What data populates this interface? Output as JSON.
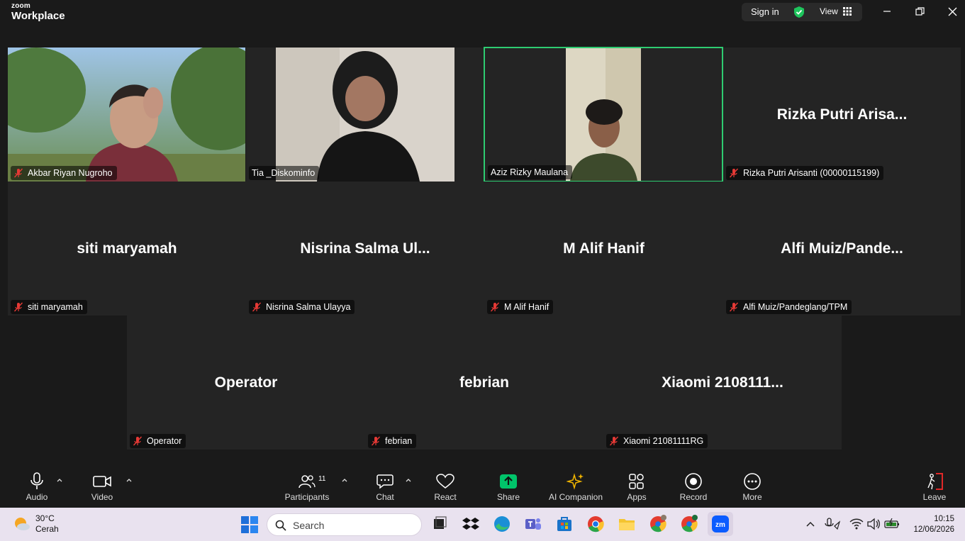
{
  "app": {
    "brand_small": "zoom",
    "brand_large": "Workplace"
  },
  "titlebar": {
    "signin_label": "Sign in",
    "view_label": "View"
  },
  "tiles": [
    {
      "name": "Akbar Riyan Nugroho",
      "label": "Akbar Riyan Nugroho",
      "video": true,
      "muted": true
    },
    {
      "name": "Tia _Diskominfo",
      "label": "Tia _Diskominfo",
      "video": true,
      "muted": false
    },
    {
      "name": "Aziz Rizky Maulana",
      "label": "Aziz Rizky Maulana",
      "video": true,
      "muted": false,
      "active": true
    },
    {
      "big": "Rizka  Putri  Arisa...",
      "label": "Rizka Putri Arisanti (00000115199)",
      "muted": true
    },
    {
      "big": "siti maryamah",
      "label": "siti maryamah",
      "muted": true
    },
    {
      "big": "Nisrina  Salma  Ul...",
      "label": "Nisrina Salma Ulayya",
      "muted": true
    },
    {
      "big": "M Alif Hanif",
      "label": "M Alif Hanif",
      "muted": true
    },
    {
      "big": "Alfi  Muiz/Pande...",
      "label": "Alfi Muiz/Pandeglang/TPM",
      "muted": true
    },
    {
      "big": "Operator",
      "label": "Operator",
      "muted": true
    },
    {
      "big": "febrian",
      "label": "febrian",
      "muted": true
    },
    {
      "big": "Xiaomi  2108111...",
      "label": "Xiaomi 21081111RG",
      "muted": true
    }
  ],
  "toolbar": {
    "audio": "Audio",
    "video": "Video",
    "participants": "Participants",
    "participants_count": "11",
    "chat": "Chat",
    "react": "React",
    "share": "Share",
    "ai_companion": "AI Companion",
    "apps": "Apps",
    "record": "Record",
    "more": "More",
    "leave": "Leave"
  },
  "taskbar": {
    "temperature": "30°C",
    "condition": "Cerah",
    "search_placeholder": "Search",
    "time": "10:15",
    "date": "12/06/2026"
  },
  "colors": {
    "active_border": "#2ecc71",
    "share_green": "#00c46a",
    "leave_red": "#e02828",
    "mute_red": "#e53935"
  }
}
